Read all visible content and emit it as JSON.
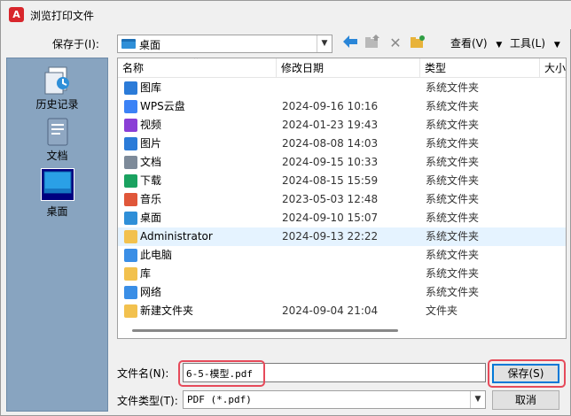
{
  "window": {
    "title": "浏览打印文件",
    "app_icon": "autocad-icon"
  },
  "toolbar": {
    "save_in_label": "保存于(I):",
    "save_in_value": "桌面",
    "view_menu": "查看(V)",
    "tools_menu": "工具(L)"
  },
  "places": [
    {
      "label": "历史记录",
      "icon": "history-icon"
    },
    {
      "label": "文档",
      "icon": "documents-icon"
    },
    {
      "label": "桌面",
      "icon": "desktop-icon",
      "selected": true
    }
  ],
  "columns": [
    "名称",
    "修改日期",
    "类型",
    "大小"
  ],
  "files": [
    {
      "name": "图库",
      "date": "",
      "type": "系统文件夹",
      "icon": "gallery-icon",
      "color": "#2b7bd8"
    },
    {
      "name": "WPS云盘",
      "date": "2024-09-16 10:16",
      "type": "系统文件夹",
      "icon": "cloud-icon",
      "color": "#3b82f6"
    },
    {
      "name": "视频",
      "date": "2024-01-23 19:43",
      "type": "系统文件夹",
      "icon": "video-icon",
      "color": "#8a3fd6"
    },
    {
      "name": "图片",
      "date": "2024-08-08 14:03",
      "type": "系统文件夹",
      "icon": "pictures-icon",
      "color": "#2b7bd8"
    },
    {
      "name": "文档",
      "date": "2024-09-15 10:33",
      "type": "系统文件夹",
      "icon": "documents-icon",
      "color": "#7d8a99"
    },
    {
      "name": "下载",
      "date": "2024-08-15 15:59",
      "type": "系统文件夹",
      "icon": "download-icon",
      "color": "#1aa260"
    },
    {
      "name": "音乐",
      "date": "2023-05-03 12:48",
      "type": "系统文件夹",
      "icon": "music-icon",
      "color": "#e0573a"
    },
    {
      "name": "桌面",
      "date": "2024-09-10 15:07",
      "type": "系统文件夹",
      "icon": "desktop-icon",
      "color": "#2f8fd8"
    },
    {
      "name": "Administrator",
      "date": "2024-09-13 22:22",
      "type": "系统文件夹",
      "icon": "user-folder-icon",
      "color": "#f2c14e"
    },
    {
      "name": "此电脑",
      "date": "",
      "type": "系统文件夹",
      "icon": "computer-icon",
      "color": "#3a8ee6"
    },
    {
      "name": "库",
      "date": "",
      "type": "系统文件夹",
      "icon": "library-icon",
      "color": "#f2c14e"
    },
    {
      "name": "网络",
      "date": "",
      "type": "系统文件夹",
      "icon": "network-icon",
      "color": "#3a8ee6"
    },
    {
      "name": "新建文件夹",
      "date": "2024-09-04 21:04",
      "type": "文件夹",
      "icon": "folder-icon",
      "color": "#f2c14e"
    }
  ],
  "selected_file": "Administrator",
  "filename": {
    "label": "文件名(N):",
    "value": "6-5-模型.pdf"
  },
  "filetype": {
    "label": "文件类型(T):",
    "value": "PDF (*.pdf)"
  },
  "buttons": {
    "save": "保存(S)",
    "cancel": "取消"
  }
}
